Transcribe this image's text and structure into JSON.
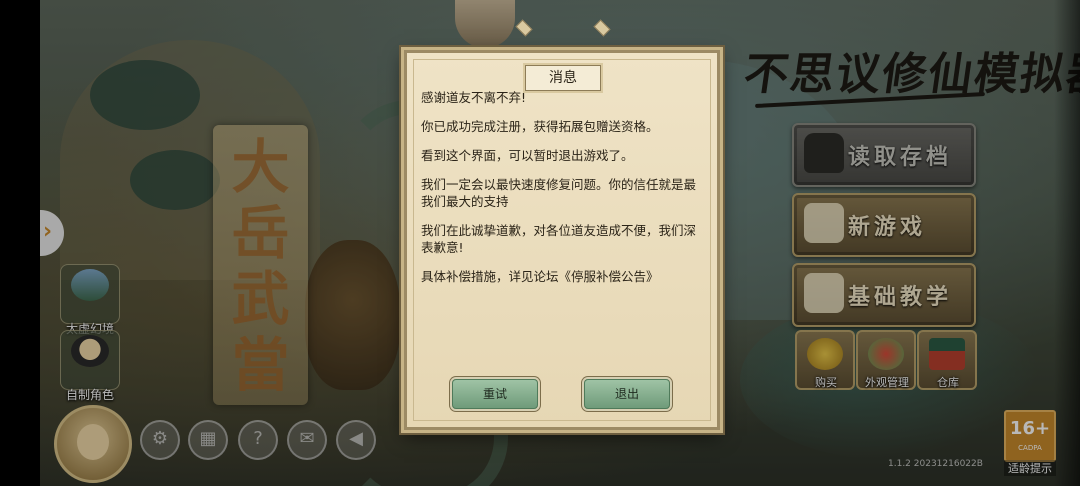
{
  "background": {
    "banner_chars": [
      "大",
      "岳",
      "武",
      "當"
    ]
  },
  "logo": {
    "text": "不思议修仙模拟器"
  },
  "left_panel": {
    "arrow": "›",
    "items": [
      {
        "label": "太虚幻境",
        "icon": "mountain-icon"
      },
      {
        "label": "自制角色",
        "icon": "character-icon"
      }
    ]
  },
  "right_menu": {
    "load_save": "读取存档",
    "new_game": "新游戏",
    "tutorial": "基础教学",
    "small_buttons": [
      {
        "label": "购买",
        "icon": "coin-icon"
      },
      {
        "label": "外观管理",
        "icon": "lion-dance-icon"
      },
      {
        "label": "仓库",
        "icon": "warehouse-icon"
      }
    ]
  },
  "bottom_toolbar": {
    "icons": [
      "settings-icon",
      "gallery-icon",
      "help-icon",
      "mail-icon",
      "sound-icon"
    ],
    "glyphs": [
      "⚙",
      "▦",
      "?",
      "✉",
      "◀"
    ]
  },
  "dialog": {
    "title": "消息",
    "paragraphs": [
      "感谢道友不离不弃!",
      "你已成功完成注册，获得拓展包赠送资格。",
      "看到这个界面，可以暂时退出游戏了。",
      "我们一定会以最快速度修复问题。你的信任就是最我们最大的支持",
      "我们在此诚挚道歉，对各位道友造成不便，我们深表歉意!",
      "具体补偿措施，详见论坛《停服补偿公告》"
    ],
    "retry_button": "重试",
    "exit_button": "退出"
  },
  "footer": {
    "version": "1.1.2 20231216022B",
    "age_rating": "16+",
    "age_org": "CADPA",
    "age_hint": "适龄提示"
  }
}
